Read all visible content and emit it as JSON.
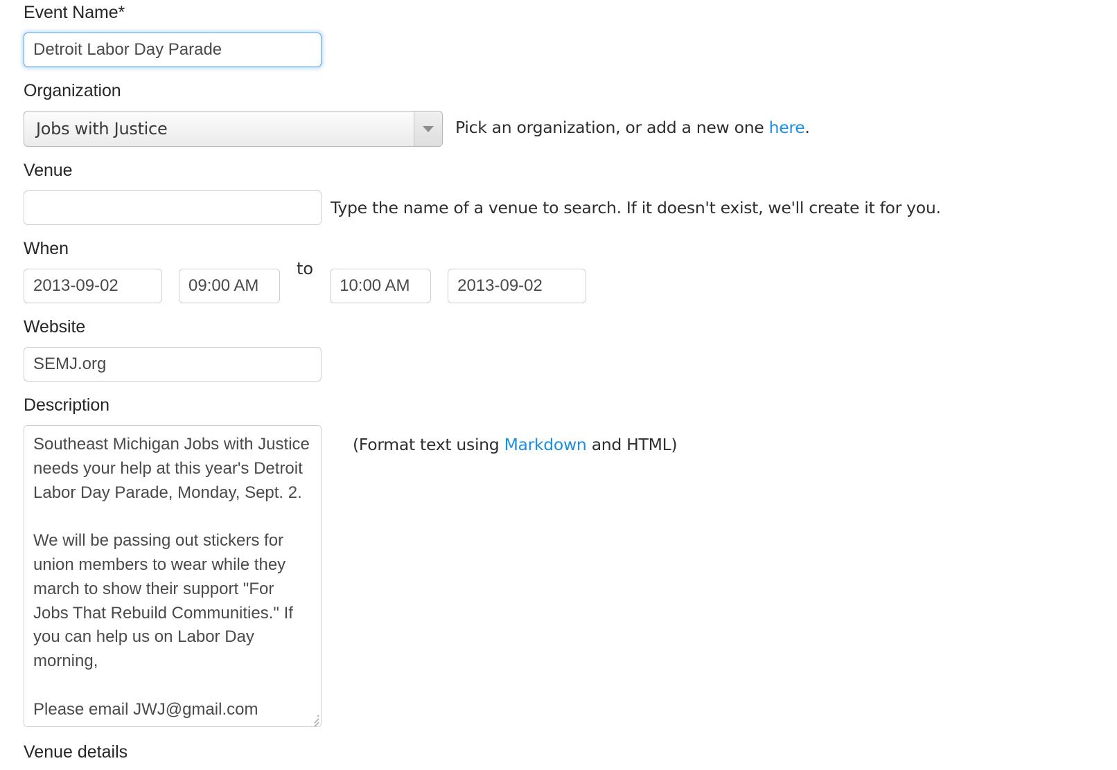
{
  "form": {
    "event_name": {
      "label": "Event Name*",
      "value": "Detroit Labor Day Parade",
      "placeholder": ""
    },
    "organization": {
      "label": "Organization",
      "selected": "Jobs with Justice",
      "options": [
        "Jobs with Justice"
      ],
      "help_prefix": "Pick an organization, or add a new one ",
      "help_link": "here",
      "help_suffix": ".",
      "caret_icon": "chevron-down-icon"
    },
    "venue": {
      "label": "Venue",
      "value": "",
      "placeholder": "",
      "help": "Type the name of a venue to search. If it doesn't exist, we'll create it for you."
    },
    "when": {
      "label": "When",
      "start_date": "2013-09-02",
      "start_time": "09:00 AM",
      "separator": "to",
      "end_time": "10:00 AM",
      "end_date": "2013-09-02"
    },
    "website": {
      "label": "Website",
      "value": "SEMJ.org",
      "placeholder": ""
    },
    "description": {
      "label": "Description",
      "value": "Southeast Michigan Jobs with Justice needs your help at this year's Detroit Labor Day Parade, Monday, Sept. 2.\n\nWe will be passing out stickers for union members to wear while they march to show their support \"For Jobs That Rebuild Communities.\" If you can help us on Labor Day morning,\n\nPlease email JWJ@gmail.com",
      "help_prefix": "(Format text using ",
      "help_link": "Markdown",
      "help_suffix": " and HTML)",
      "resize_handle": "resize-grip-icon"
    },
    "venue_details": {
      "label": "Venue details"
    }
  },
  "colors": {
    "link": "#1c8fe0",
    "focus_border": "#61a9e8",
    "input_border": "#cfcfcf",
    "label_text": "#262626",
    "input_text": "#4a4a4a"
  }
}
